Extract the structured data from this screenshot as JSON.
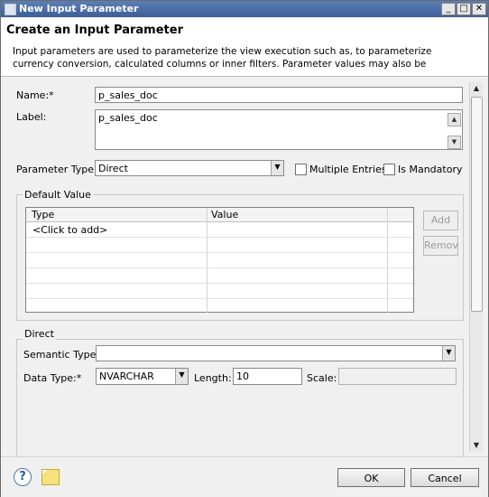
{
  "window": {
    "title": "New Input Parameter",
    "controls": {
      "minimize": "_",
      "maximize": "□",
      "close": "✕"
    }
  },
  "header": {
    "heading": "Create an Input Parameter",
    "description": "Input parameters are used to parameterize the view execution such as, to parameterize currency conversion, calculated columns or inner filters. Parameter values may also be"
  },
  "form": {
    "name_label": "Name:*",
    "name_value": "p_sales_doc",
    "label_label": "Label:",
    "label_value": "p_sales_doc",
    "param_type_label": "Parameter Type:",
    "param_type_value": "Direct",
    "multiple_entries_label": "Multiple Entries",
    "is_mandatory_label": "Is Mandatory"
  },
  "default_value": {
    "title": "Default Value",
    "columns": [
      "Type",
      "Value"
    ],
    "rows": [
      "<Click to add>"
    ],
    "add_button": "Add",
    "remove_button": "Remove"
  },
  "direct": {
    "title": "Direct",
    "semantic_type_label": "Semantic Type:",
    "semantic_type_value": "",
    "data_type_label": "Data Type:*",
    "data_type_value": "NVARCHAR",
    "length_label": "Length:",
    "length_value": "10",
    "scale_label": "Scale:",
    "scale_value": ""
  },
  "footer": {
    "ok": "OK",
    "cancel": "Cancel"
  },
  "icons": [
    "app-icon",
    "help-icon",
    "note-icon",
    "dropdown-arrow-icon",
    "scroll-up-icon",
    "scroll-down-icon"
  ]
}
